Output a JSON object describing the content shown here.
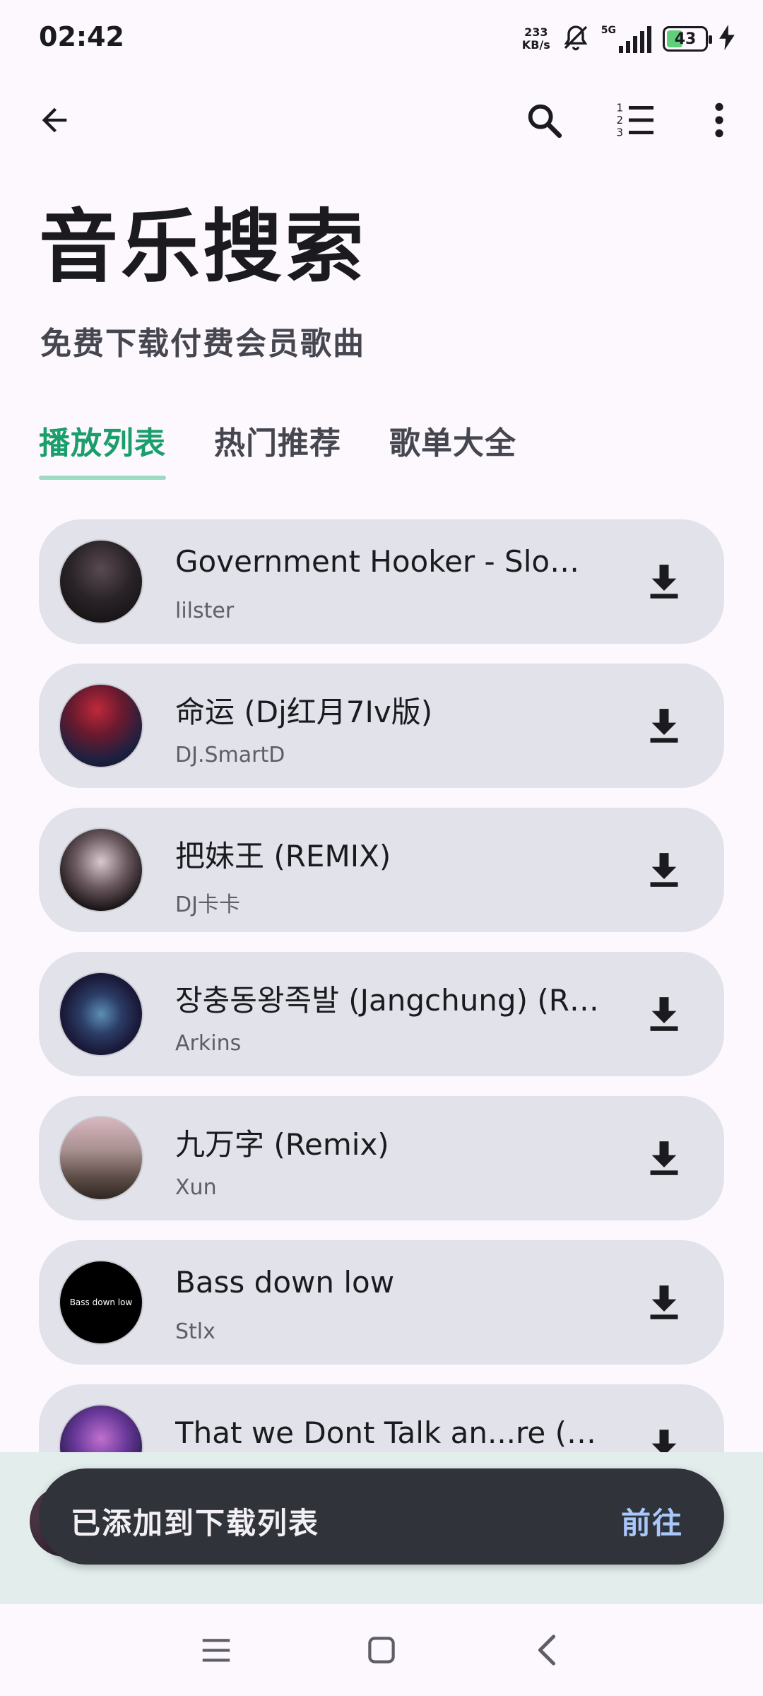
{
  "status_bar": {
    "time": "02:42",
    "net_speed_value": "233",
    "net_speed_unit": "KB/s",
    "network": "5G",
    "battery": "43",
    "battery_level": 0.43
  },
  "app_bar": {
    "icons": [
      "back-arrow-icon",
      "search-icon",
      "sort-list-icon",
      "more-vert-icon"
    ]
  },
  "header": {
    "title": "音乐搜索",
    "subtitle": "免费下载付费会员歌曲"
  },
  "tabs": [
    {
      "label": "播放列表",
      "active": true
    },
    {
      "label": "热门推荐",
      "active": false
    },
    {
      "label": "歌单大全",
      "active": false
    }
  ],
  "songs": [
    {
      "title": "Government Hooker - Slowe…",
      "artist": "lilster"
    },
    {
      "title": "命运 (Dj红月7Iv版)",
      "artist": "DJ.SmartD"
    },
    {
      "title": "把妹王 (REMIX)",
      "artist": "DJ卡卡"
    },
    {
      "title": "장충동왕족발 (Jangchung) (R…",
      "artist": "Arkins"
    },
    {
      "title": "九万字 (Remix)",
      "artist": "Xun"
    },
    {
      "title": "Bass down low",
      "artist": "Stlx",
      "cover_text": "Bass down low"
    },
    {
      "title": "That we Dont Talk an...re (巴…",
      "artist": ""
    }
  ],
  "snackbar": {
    "message": "已添加到下载列表",
    "action": "前往"
  },
  "colors": {
    "accent": "#1a9e6b",
    "card": "#e1e2ea",
    "snackbar": "#30333a",
    "snackbar_action": "#a8c7fa"
  }
}
